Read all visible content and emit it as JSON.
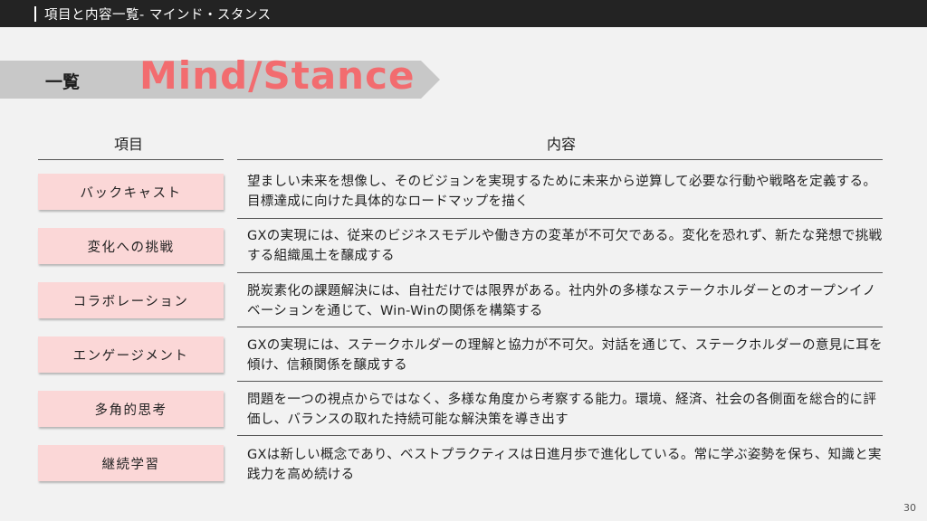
{
  "header": {
    "title": "項目と内容一覧- マインド・スタンス"
  },
  "banner": {
    "label": "一覧",
    "big_title": "Mind/Stance"
  },
  "columns": {
    "item": "項目",
    "content": "内容"
  },
  "rows": [
    {
      "label": "バックキャスト",
      "text": "望ましい未来を想像し、そのビジョンを実現するために未来から逆算して必要な行動や戦略を定義する。目標達成に向けた具体的なロードマップを描く"
    },
    {
      "label": "変化への挑戦",
      "text": "GXの実現には、従来のビジネスモデルや働き方の変革が不可欠である。変化を恐れず、新たな発想で挑戦する組織風土を醸成する"
    },
    {
      "label": "コラボレーション",
      "text": "脱炭素化の課題解決には、自社だけでは限界がある。社内外の多様なステークホルダーとのオープンイノベーションを通じて、Win-Winの関係を構築する"
    },
    {
      "label": "エンゲージメント",
      "text": "GXの実現には、ステークホルダーの理解と協力が不可欠。対話を通じて、ステークホルダーの意見に耳を傾け、信頼関係を醸成する"
    },
    {
      "label": "多角的思考",
      "text": "問題を一つの視点からではなく、多様な角度から考察する能力。環境、経済、社会の各側面を総合的に評価し、バランスの取れた持続可能な解決策を導き出す"
    },
    {
      "label": "継続学習",
      "text": "GXは新しい概念であり、ベストプラクティスは日進月歩で進化している。常に学ぶ姿勢を保ち、知識と実践力を高め続ける"
    }
  ],
  "footer": {
    "page_number": "30"
  },
  "colors": {
    "accent": "#f26c6f",
    "label_bg": "#fbd7d7",
    "banner_bg": "#c8c8c8",
    "topbar_bg": "#232323"
  }
}
